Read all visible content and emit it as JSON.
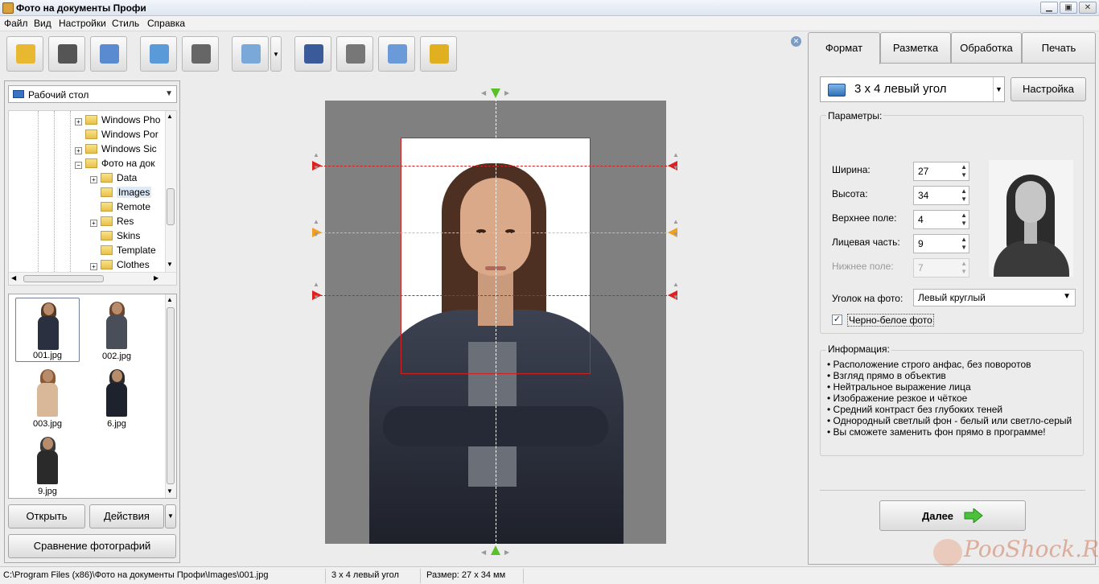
{
  "window": {
    "title": "Фото на документы Профи"
  },
  "menu": [
    "Файл",
    "Вид",
    "Настройки",
    "Стиль",
    "Справка"
  ],
  "toolbar": {
    "buttons": [
      {
        "name": "open-folder-icon",
        "color": "#e8b830"
      },
      {
        "name": "save-icon",
        "color": "#555555"
      },
      {
        "name": "print-icon",
        "color": "#5a8ad0"
      },
      {
        "name": "user-icon",
        "color": "#5a9ad8"
      },
      {
        "name": "camera-icon",
        "color": "#666666"
      },
      {
        "name": "monitor-icon",
        "color": "#7aa8d8"
      },
      {
        "name": "help-book-icon",
        "color": "#3a5a9a"
      },
      {
        "name": "video-reel-icon",
        "color": "#777777"
      },
      {
        "name": "home-icon",
        "color": "#6a9ad8"
      },
      {
        "name": "shop-cart-icon",
        "color": "#e0b020"
      }
    ]
  },
  "left": {
    "folder": "Рабочий стол",
    "tree": [
      {
        "label": "Windows Pho",
        "level": 0,
        "expand": "+"
      },
      {
        "label": "Windows Por",
        "level": 0,
        "expand": ""
      },
      {
        "label": "Windows Sic",
        "level": 0,
        "expand": "+"
      },
      {
        "label": "Фото на док",
        "level": 0,
        "expand": "−"
      },
      {
        "label": "Data",
        "level": 1,
        "expand": "+"
      },
      {
        "label": "Images",
        "level": 1,
        "expand": "",
        "selected": true
      },
      {
        "label": "Remote",
        "level": 1,
        "expand": ""
      },
      {
        "label": "Res",
        "level": 1,
        "expand": "+"
      },
      {
        "label": "Skins",
        "level": 1,
        "expand": ""
      },
      {
        "label": "Template",
        "level": 1,
        "expand": ""
      },
      {
        "label": "Clothes",
        "level": 1,
        "expand": "+"
      }
    ],
    "thumbs": [
      {
        "file": "001.jpg",
        "selected": true,
        "hair": "#5a3a25",
        "body": "#2b3040"
      },
      {
        "file": "002.jpg",
        "selected": false,
        "hair": "#6a4530",
        "body": "#4a4e58"
      },
      {
        "file": "003.jpg",
        "selected": false,
        "hair": "#8a5a35",
        "body": "#d9b89a"
      },
      {
        "file": "6.jpg",
        "selected": false,
        "hair": "#2a2a2a",
        "body": "#1e222c"
      },
      {
        "file": "9.jpg",
        "selected": false,
        "hair": "#3a3a3a",
        "body": "#2a2a2a"
      }
    ],
    "open_label": "Открыть",
    "actions_label": "Действия",
    "compare_label": "Сравнение фотографий"
  },
  "tabs": [
    "Формат",
    "Разметка",
    "Обработка",
    "Печать"
  ],
  "format": {
    "selected": "3 х 4 левый угол",
    "settings_label": "Настройка",
    "params_title": "Параметры:",
    "params": [
      {
        "label": "Ширина:",
        "value": "27",
        "disabled": false
      },
      {
        "label": "Высота:",
        "value": "34",
        "disabled": false
      },
      {
        "label": "Верхнее поле:",
        "value": "4",
        "disabled": false
      },
      {
        "label": "Лицевая часть:",
        "value": "9",
        "disabled": false
      },
      {
        "label": "Нижнее поле:",
        "value": "7",
        "disabled": true
      }
    ],
    "corner_label": "Уголок на фото:",
    "corner_value": "Левый круглый",
    "bw_label": "Черно-белое фото",
    "bw_checked": true,
    "info_title": "Информация:",
    "info": [
      "Расположение строго анфас, без поворотов",
      "Взгляд прямо в объектив",
      "Нейтральное выражение лица",
      "Изображение резкое и чёткое",
      "Средний контраст без глубоких теней",
      "Однородный светлый фон - белый или светло-серый",
      "Вы сможете заменить фон прямо в программе!"
    ],
    "next_label": "Далее"
  },
  "status": {
    "path": "C:\\Program Files (x86)\\Фото на документы Профи\\Images\\001.jpg",
    "format": "3 х 4 левый угол",
    "size": "Размер: 27 х 34 мм"
  },
  "watermark": "PooShock.Ru"
}
